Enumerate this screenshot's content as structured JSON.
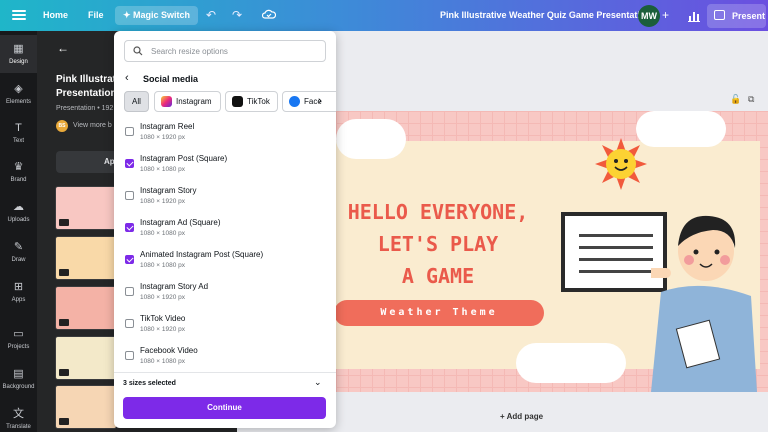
{
  "topbar": {
    "home_label": "Home",
    "file_label": "File",
    "magic_label": "Magic Switch",
    "doc_title": "Pink Illustrative Weather Quiz Game Presentation",
    "avatar_initials": "MW",
    "present_label": "Present"
  },
  "rail": [
    {
      "label": "Design",
      "icon": "design-icon"
    },
    {
      "label": "Elements",
      "icon": "elements-icon"
    },
    {
      "label": "Text",
      "icon": "text-icon"
    },
    {
      "label": "Brand",
      "icon": "brand-icon"
    },
    {
      "label": "Uploads",
      "icon": "uploads-icon"
    },
    {
      "label": "Draw",
      "icon": "draw-icon"
    },
    {
      "label": "Apps",
      "icon": "apps-icon"
    },
    {
      "label": "Projects",
      "icon": "projects-icon"
    },
    {
      "label": "Background",
      "icon": "background-icon"
    },
    {
      "label": "Translate",
      "icon": "translate-icon"
    }
  ],
  "panel": {
    "title_line1": "Pink Illustrativ",
    "title_line2": "Presentation",
    "subtitle": "Presentation • 192",
    "author_initials": "BS",
    "view_more": "View more b",
    "apply_label": "Ap"
  },
  "dropdown": {
    "search_placeholder": "Search resize options",
    "category": "Social media",
    "chips": [
      "All",
      "Instagram",
      "TikTok",
      "Face"
    ],
    "options": [
      {
        "name": "Instagram Reel",
        "size": "1080 × 1920 px",
        "checked": false
      },
      {
        "name": "Instagram Post (Square)",
        "size": "1080 × 1080 px",
        "checked": true
      },
      {
        "name": "Instagram Story",
        "size": "1080 × 1920 px",
        "checked": false
      },
      {
        "name": "Instagram Ad (Square)",
        "size": "1080 × 1080 px",
        "checked": true
      },
      {
        "name": "Animated Instagram Post (Square)",
        "size": "1080 × 1080 px",
        "checked": true
      },
      {
        "name": "Instagram Story Ad",
        "size": "1080 × 1920 px",
        "checked": false
      },
      {
        "name": "TikTok Video",
        "size": "1080 × 1920 px",
        "checked": false
      },
      {
        "name": "Facebook Video",
        "size": "1080 × 1080 px",
        "checked": false
      }
    ],
    "selected_count": "3 sizes selected",
    "continue_label": "Continue"
  },
  "slide": {
    "line1": "HELLO EVERYONE,",
    "line2": "LET'S PLAY",
    "line3": "A GAME",
    "theme": "Weather Theme"
  },
  "canvas": {
    "add_page": "+ Add page"
  },
  "colors": {
    "accent": "#7d2ae8",
    "slide_text": "#ea5a4b",
    "slide_bg": "#f8c8c4"
  }
}
